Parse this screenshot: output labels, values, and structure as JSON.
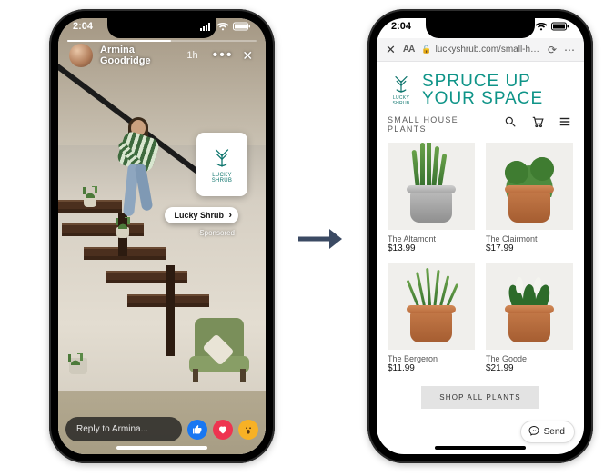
{
  "status_time": "2:04",
  "left": {
    "user_name": "Armina Goodridge",
    "time_ago": "1h",
    "brand_logo_line1": "LUCKY",
    "brand_logo_line2": "SHRUB",
    "pill_label": "Lucky Shrub",
    "sponsored_label": "Sponsored",
    "reply_placeholder": "Reply to Armina..."
  },
  "right": {
    "url": "luckyshrub.com/small-h…",
    "headline_line1": "SPRUCE UP",
    "headline_line2": "YOUR SPACE",
    "logo_line1": "LUCKY",
    "logo_line2": "SHRUB",
    "category": "SMALL HOUSE PLANTS",
    "products": [
      {
        "name": "The Altamont",
        "price": "$13.99"
      },
      {
        "name": "The Clairmont",
        "price": "$17.99"
      },
      {
        "name": "The Bergeron",
        "price": "$11.99"
      },
      {
        "name": "The Goode",
        "price": "$21.99"
      }
    ],
    "shop_all_label": "SHOP ALL PLANTS",
    "send_label": "Send"
  }
}
